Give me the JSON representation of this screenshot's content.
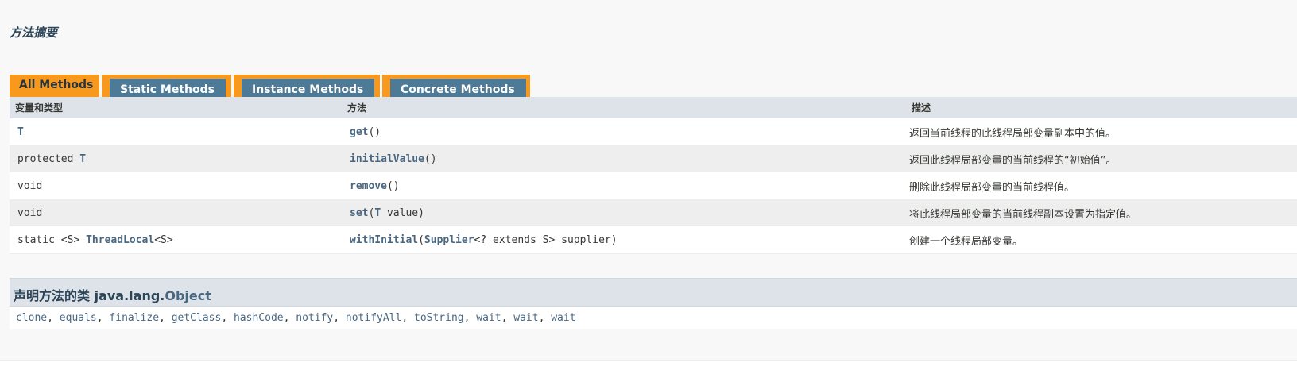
{
  "summary_title": "方法摘要",
  "tabs": [
    {
      "label": "All Methods",
      "active": true
    },
    {
      "label": "Static Methods",
      "active": false
    },
    {
      "label": "Instance Methods",
      "active": false
    },
    {
      "label": "Concrete Methods",
      "active": false
    }
  ],
  "table": {
    "headers": [
      "变量和类型",
      "方法",
      "描述"
    ],
    "rows": [
      {
        "type_prefix": "",
        "type_link": "T",
        "type_suffix": "",
        "method_name": "get",
        "method_params_prefix": "()",
        "method_params_link": "",
        "method_params_suffix": "",
        "description": "返回当前线程的此线程局部变量副本中的值。"
      },
      {
        "type_prefix": "protected ",
        "type_link": "T",
        "type_suffix": "",
        "method_name": "initialValue",
        "method_params_prefix": "()",
        "method_params_link": "",
        "method_params_suffix": "",
        "description": "返回此线程局部变量的当前线程的“初始值”。"
      },
      {
        "type_prefix": "void",
        "type_link": "",
        "type_suffix": "",
        "method_name": "remove",
        "method_params_prefix": "()",
        "method_params_link": "",
        "method_params_suffix": "",
        "description": "删除此线程局部变量的当前线程值。"
      },
      {
        "type_prefix": "void",
        "type_link": "",
        "type_suffix": "",
        "method_name": "set",
        "method_params_prefix": "(",
        "method_params_link": "T",
        "method_params_suffix": " value)",
        "description": "将此线程局部变量的当前线程副本设置为指定值。"
      },
      {
        "type_prefix": "static <S> ",
        "type_link": "ThreadLocal",
        "type_suffix": "<S>",
        "method_name": "withInitial",
        "method_params_prefix": "(",
        "method_params_link": "Supplier",
        "method_params_suffix": "<? extends S> supplier)",
        "description": "创建一个线程局部变量。"
      }
    ]
  },
  "inherited": {
    "title_prefix": "声明方法的类 java.lang.",
    "title_link": "Object",
    "methods": [
      "clone",
      "equals",
      "finalize",
      "getClass",
      "hashCode",
      "notify",
      "notifyAll",
      "toString",
      "wait",
      "wait",
      "wait"
    ],
    "separator": ", "
  },
  "colors": {
    "tab_orange": "#f8981d",
    "tab_blue": "#4d7a97",
    "header_bg": "#dee3e9",
    "link": "#4a6782",
    "row_alt": "#eeeeef"
  }
}
